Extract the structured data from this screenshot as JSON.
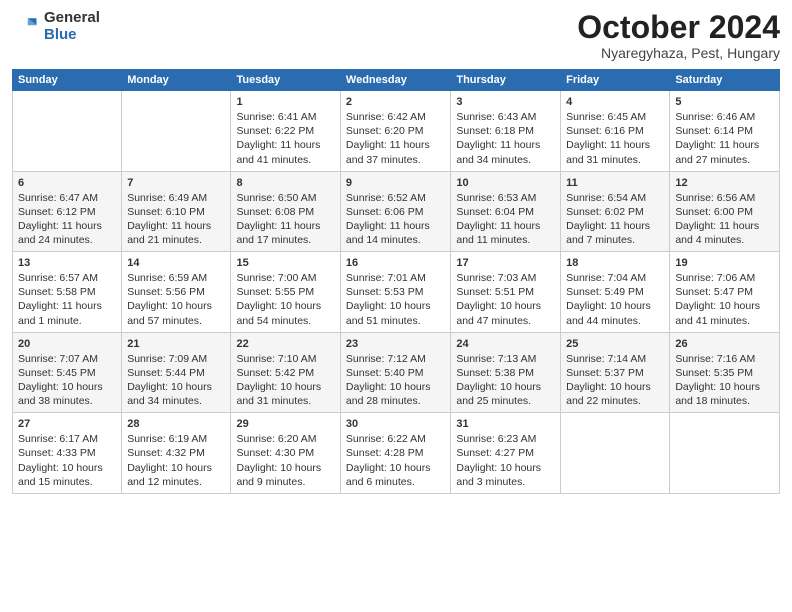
{
  "logo": {
    "general": "General",
    "blue": "Blue"
  },
  "title": {
    "month": "October 2024",
    "location": "Nyaregyhaza, Pest, Hungary"
  },
  "weekdays": [
    "Sunday",
    "Monday",
    "Tuesday",
    "Wednesday",
    "Thursday",
    "Friday",
    "Saturday"
  ],
  "weeks": [
    [
      {
        "day": "",
        "content": ""
      },
      {
        "day": "",
        "content": ""
      },
      {
        "day": "1",
        "content": "Sunrise: 6:41 AM\nSunset: 6:22 PM\nDaylight: 11 hours and 41 minutes."
      },
      {
        "day": "2",
        "content": "Sunrise: 6:42 AM\nSunset: 6:20 PM\nDaylight: 11 hours and 37 minutes."
      },
      {
        "day": "3",
        "content": "Sunrise: 6:43 AM\nSunset: 6:18 PM\nDaylight: 11 hours and 34 minutes."
      },
      {
        "day": "4",
        "content": "Sunrise: 6:45 AM\nSunset: 6:16 PM\nDaylight: 11 hours and 31 minutes."
      },
      {
        "day": "5",
        "content": "Sunrise: 6:46 AM\nSunset: 6:14 PM\nDaylight: 11 hours and 27 minutes."
      }
    ],
    [
      {
        "day": "6",
        "content": "Sunrise: 6:47 AM\nSunset: 6:12 PM\nDaylight: 11 hours and 24 minutes."
      },
      {
        "day": "7",
        "content": "Sunrise: 6:49 AM\nSunset: 6:10 PM\nDaylight: 11 hours and 21 minutes."
      },
      {
        "day": "8",
        "content": "Sunrise: 6:50 AM\nSunset: 6:08 PM\nDaylight: 11 hours and 17 minutes."
      },
      {
        "day": "9",
        "content": "Sunrise: 6:52 AM\nSunset: 6:06 PM\nDaylight: 11 hours and 14 minutes."
      },
      {
        "day": "10",
        "content": "Sunrise: 6:53 AM\nSunset: 6:04 PM\nDaylight: 11 hours and 11 minutes."
      },
      {
        "day": "11",
        "content": "Sunrise: 6:54 AM\nSunset: 6:02 PM\nDaylight: 11 hours and 7 minutes."
      },
      {
        "day": "12",
        "content": "Sunrise: 6:56 AM\nSunset: 6:00 PM\nDaylight: 11 hours and 4 minutes."
      }
    ],
    [
      {
        "day": "13",
        "content": "Sunrise: 6:57 AM\nSunset: 5:58 PM\nDaylight: 11 hours and 1 minute."
      },
      {
        "day": "14",
        "content": "Sunrise: 6:59 AM\nSunset: 5:56 PM\nDaylight: 10 hours and 57 minutes."
      },
      {
        "day": "15",
        "content": "Sunrise: 7:00 AM\nSunset: 5:55 PM\nDaylight: 10 hours and 54 minutes."
      },
      {
        "day": "16",
        "content": "Sunrise: 7:01 AM\nSunset: 5:53 PM\nDaylight: 10 hours and 51 minutes."
      },
      {
        "day": "17",
        "content": "Sunrise: 7:03 AM\nSunset: 5:51 PM\nDaylight: 10 hours and 47 minutes."
      },
      {
        "day": "18",
        "content": "Sunrise: 7:04 AM\nSunset: 5:49 PM\nDaylight: 10 hours and 44 minutes."
      },
      {
        "day": "19",
        "content": "Sunrise: 7:06 AM\nSunset: 5:47 PM\nDaylight: 10 hours and 41 minutes."
      }
    ],
    [
      {
        "day": "20",
        "content": "Sunrise: 7:07 AM\nSunset: 5:45 PM\nDaylight: 10 hours and 38 minutes."
      },
      {
        "day": "21",
        "content": "Sunrise: 7:09 AM\nSunset: 5:44 PM\nDaylight: 10 hours and 34 minutes."
      },
      {
        "day": "22",
        "content": "Sunrise: 7:10 AM\nSunset: 5:42 PM\nDaylight: 10 hours and 31 minutes."
      },
      {
        "day": "23",
        "content": "Sunrise: 7:12 AM\nSunset: 5:40 PM\nDaylight: 10 hours and 28 minutes."
      },
      {
        "day": "24",
        "content": "Sunrise: 7:13 AM\nSunset: 5:38 PM\nDaylight: 10 hours and 25 minutes."
      },
      {
        "day": "25",
        "content": "Sunrise: 7:14 AM\nSunset: 5:37 PM\nDaylight: 10 hours and 22 minutes."
      },
      {
        "day": "26",
        "content": "Sunrise: 7:16 AM\nSunset: 5:35 PM\nDaylight: 10 hours and 18 minutes."
      }
    ],
    [
      {
        "day": "27",
        "content": "Sunrise: 6:17 AM\nSunset: 4:33 PM\nDaylight: 10 hours and 15 minutes."
      },
      {
        "day": "28",
        "content": "Sunrise: 6:19 AM\nSunset: 4:32 PM\nDaylight: 10 hours and 12 minutes."
      },
      {
        "day": "29",
        "content": "Sunrise: 6:20 AM\nSunset: 4:30 PM\nDaylight: 10 hours and 9 minutes."
      },
      {
        "day": "30",
        "content": "Sunrise: 6:22 AM\nSunset: 4:28 PM\nDaylight: 10 hours and 6 minutes."
      },
      {
        "day": "31",
        "content": "Sunrise: 6:23 AM\nSunset: 4:27 PM\nDaylight: 10 hours and 3 minutes."
      },
      {
        "day": "",
        "content": ""
      },
      {
        "day": "",
        "content": ""
      }
    ]
  ]
}
